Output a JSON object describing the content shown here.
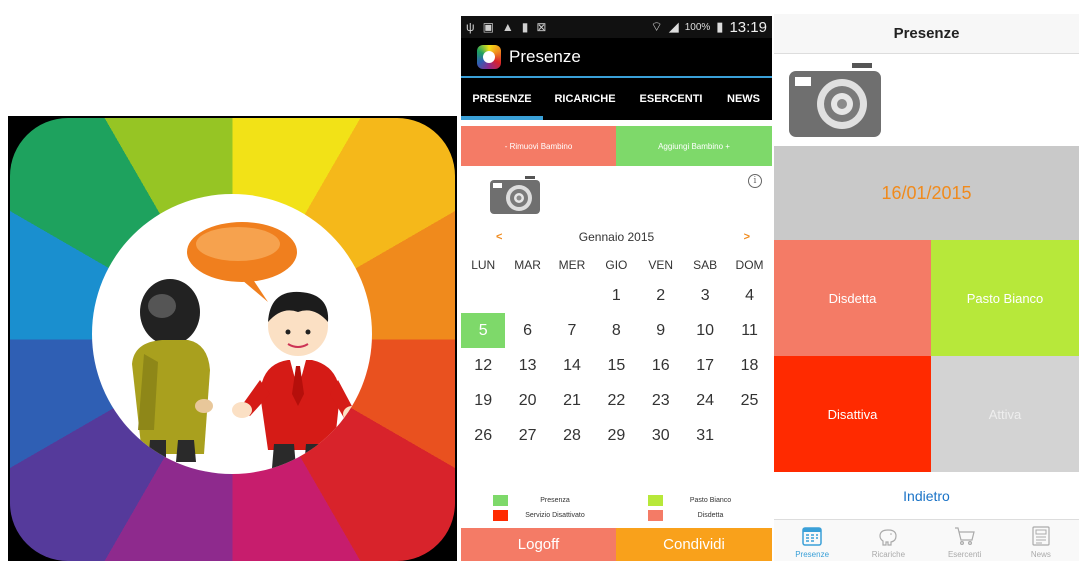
{
  "android": {
    "status": {
      "battery": "100%",
      "time": "13:19"
    },
    "app_title": "Presenze",
    "tabs": [
      "PRESENZE",
      "RICARICHE",
      "ESERCENTI",
      "NEWS"
    ],
    "remove_child": "- Rimuovi Bambino",
    "add_child": "Aggiungi Bambino +",
    "info": "i",
    "calendar": {
      "prev": "<",
      "next": ">",
      "month": "Gennaio 2015",
      "weekdays": [
        "LUN",
        "MAR",
        "MER",
        "GIO",
        "VEN",
        "SAB",
        "DOM"
      ],
      "weeks": [
        [
          "",
          "",
          "",
          "1",
          "2",
          "3",
          "4"
        ],
        [
          "5",
          "6",
          "7",
          "8",
          "9",
          "10",
          "11"
        ],
        [
          "12",
          "13",
          "14",
          "15",
          "16",
          "17",
          "18"
        ],
        [
          "19",
          "20",
          "21",
          "22",
          "23",
          "24",
          "25"
        ],
        [
          "26",
          "27",
          "28",
          "29",
          "30",
          "31",
          ""
        ]
      ]
    },
    "legend": [
      {
        "label": "Presenza",
        "color": "#7ed96a"
      },
      {
        "label": "Pasto Bianco",
        "color": "#b7e83a"
      },
      {
        "label": "Servizio Disattivato",
        "color": "#ff2a00"
      },
      {
        "label": "Disdetta",
        "color": "#f47b66"
      }
    ],
    "logoff": "Logoff",
    "share": "Condividi"
  },
  "ios": {
    "title": "Presenze",
    "date": "16/01/2015",
    "cells": {
      "disdetta": "Disdetta",
      "pasto_bianco": "Pasto Bianco",
      "disattiva": "Disattiva",
      "attiva": "Attiva"
    },
    "back": "Indietro",
    "tabbar": [
      "Presenze",
      "Ricariche",
      "Esercenti",
      "News"
    ]
  },
  "colors": {
    "accent_blue": "#3aa0d8",
    "orange": "#f08a1c",
    "salmon": "#f47b66",
    "green": "#7ed96a",
    "lime": "#b7e83a",
    "red": "#ff2a00"
  }
}
